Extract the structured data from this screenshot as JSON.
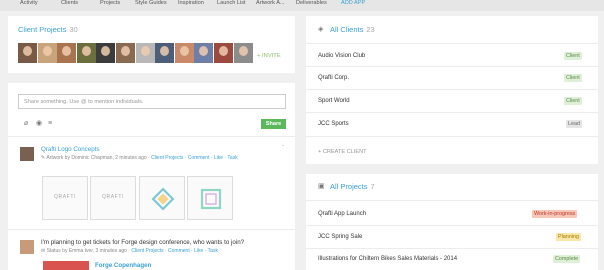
{
  "nav": {
    "items": [
      {
        "label": "Activity"
      },
      {
        "label": "Clients"
      },
      {
        "label": "Projects"
      },
      {
        "label": "Style Guides"
      },
      {
        "label": "Inspiration"
      },
      {
        "label": "Launch List"
      },
      {
        "label": "Artwork A..."
      },
      {
        "label": "Deliverables"
      },
      {
        "label": "ADD APP",
        "active": true
      }
    ]
  },
  "client_projects": {
    "title": "Client Projects",
    "count": "30",
    "invite_label": "INVITE",
    "invite_icon": "plus-icon",
    "avatar_colors": [
      "#7a5a44",
      "#c8a47c",
      "#a8734f",
      "#6b6f3d",
      "#3c3c3c",
      "#8a6a50",
      "#b8b8b8",
      "#4c5e7a",
      "#c98a6a",
      "#6d7fa6",
      "#9b4a3f",
      "#8c8c8c"
    ]
  },
  "composer": {
    "placeholder": "Share something. Use @ to mention individuals.",
    "share_label": "Share",
    "tools": [
      "paperclip-icon",
      "globe-icon",
      "list-icon"
    ]
  },
  "feed": {
    "item1": {
      "title": "Qrafti Logo Concepts",
      "meta_prefix": "Artwork by Dominic Chapman, 2 minutes ago · ",
      "meta_link": "Client Projects",
      "meta_actions": " · Comment · Like · Task",
      "thumbs": [
        {
          "text": "QRAFTI"
        },
        {
          "text": "QRAFTI"
        },
        {
          "text": ""
        },
        {
          "text": ""
        }
      ]
    },
    "item2": {
      "title": "I'm planning to get tickets for Forge design conference, who wants to join?",
      "meta_prefix": "Status by Emma Iver, 3 minutes ago · ",
      "meta_link": "Client Projects",
      "meta_actions": " · Comment · Like · Task",
      "link_title": "Forge Copenhagen"
    }
  },
  "all_clients": {
    "title": "All Clients",
    "count": "23",
    "icon": "tag-icon",
    "rows": [
      {
        "name": "Audio Vision Club",
        "status": "Client"
      },
      {
        "name": "Qrafti Corp.",
        "status": "Client"
      },
      {
        "name": "Sport World",
        "status": "Client"
      },
      {
        "name": "JCC Sports",
        "status": "Lead"
      }
    ],
    "create_label": "+ CREATE CLIENT"
  },
  "all_projects": {
    "title": "All Projects",
    "count": "7",
    "icon": "briefcase-icon",
    "rows": [
      {
        "name": "Qrafti App Launch",
        "status": "Work-in-progress"
      },
      {
        "name": "JCC Spring Sale",
        "status": "Planning"
      },
      {
        "name": "Illustrations for Chiltern Bikes Sales Materials - 2014",
        "status": "Complete"
      }
    ]
  }
}
